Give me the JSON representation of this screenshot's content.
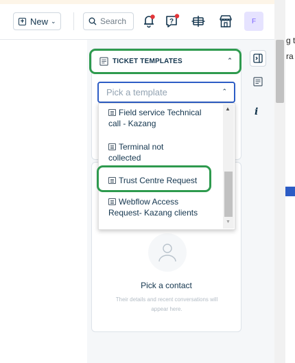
{
  "topbar": {
    "new_label": "New",
    "search_label": "Search",
    "avatar_initial": "F"
  },
  "ticket_templates": {
    "header": "TICKET TEMPLATES",
    "picker_placeholder": "Pick a template",
    "items": [
      {
        "line1": "Field service Technical",
        "line2": "call - Kazang"
      },
      {
        "line1": "Terminal not",
        "line2": "collected"
      },
      {
        "line1": "Trust Centre Request",
        "line2": ""
      },
      {
        "line1": "Webflow Access",
        "line2": "Request- Kazang clients"
      }
    ]
  },
  "contact": {
    "title": "Pick a contact",
    "hint": "Their details and recent conversations will appear here."
  },
  "background_text": {
    "line1": "g t",
    "line2": "ra"
  },
  "colors": {
    "highlight": "#2e9a4e",
    "focus_blue": "#2c5cc5",
    "notify_red": "#e43538",
    "text_dark": "#12344d"
  },
  "icons": [
    "plus-icon",
    "chevron-down-icon",
    "search-icon",
    "bell-icon",
    "help-icon",
    "apps-icon",
    "store-icon",
    "expand-panel-icon",
    "template-icon",
    "info-icon",
    "contact-icon"
  ]
}
